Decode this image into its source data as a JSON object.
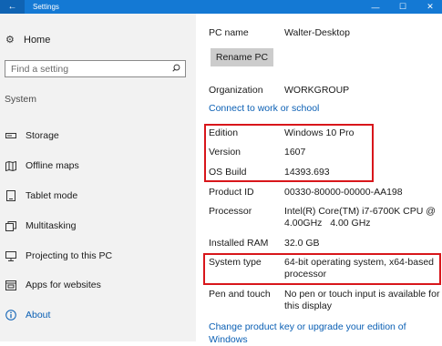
{
  "window": {
    "title": "Settings",
    "back_icon": "←",
    "minimize_icon": "—",
    "maximize_icon": "☐",
    "close_icon": "✕"
  },
  "sidebar": {
    "home_label": "Home",
    "search_placeholder": "Find a setting",
    "section_label": "System",
    "items": [
      {
        "label": "Storage",
        "icon": "storage-icon"
      },
      {
        "label": "Offline maps",
        "icon": "map-icon"
      },
      {
        "label": "Tablet mode",
        "icon": "tablet-icon"
      },
      {
        "label": "Multitasking",
        "icon": "multitasking-icon"
      },
      {
        "label": "Projecting to this PC",
        "icon": "projecting-icon"
      },
      {
        "label": "Apps for websites",
        "icon": "apps-icon"
      },
      {
        "label": "About",
        "icon": "info-icon"
      }
    ]
  },
  "main": {
    "pc_name_label": "PC name",
    "pc_name_value": "Walter-Desktop",
    "rename_button": "Rename PC",
    "organization_label": "Organization",
    "organization_value": "WORKGROUP",
    "connect_link": "Connect to work or school",
    "edition_label": "Edition",
    "edition_value": "Windows 10 Pro",
    "version_label": "Version",
    "version_value": "1607",
    "os_build_label": "OS Build",
    "os_build_value": "14393.693",
    "product_id_label": "Product ID",
    "product_id_value": "00330-80000-00000-AA198",
    "processor_label": "Processor",
    "processor_value": "Intel(R) Core(TM) i7-6700K CPU @ 4.00GHz   4.00 GHz",
    "ram_label": "Installed RAM",
    "ram_value": "32.0 GB",
    "system_type_label": "System type",
    "system_type_value": "64-bit operating system, x64-based processor",
    "pen_label": "Pen and touch",
    "pen_value": "No pen or touch input is available for this display",
    "change_key_link": "Change product key or upgrade your edition of Windows"
  },
  "colors": {
    "accent": "#1479d4",
    "link": "#0a5fb4",
    "highlight": "#d8161b"
  }
}
